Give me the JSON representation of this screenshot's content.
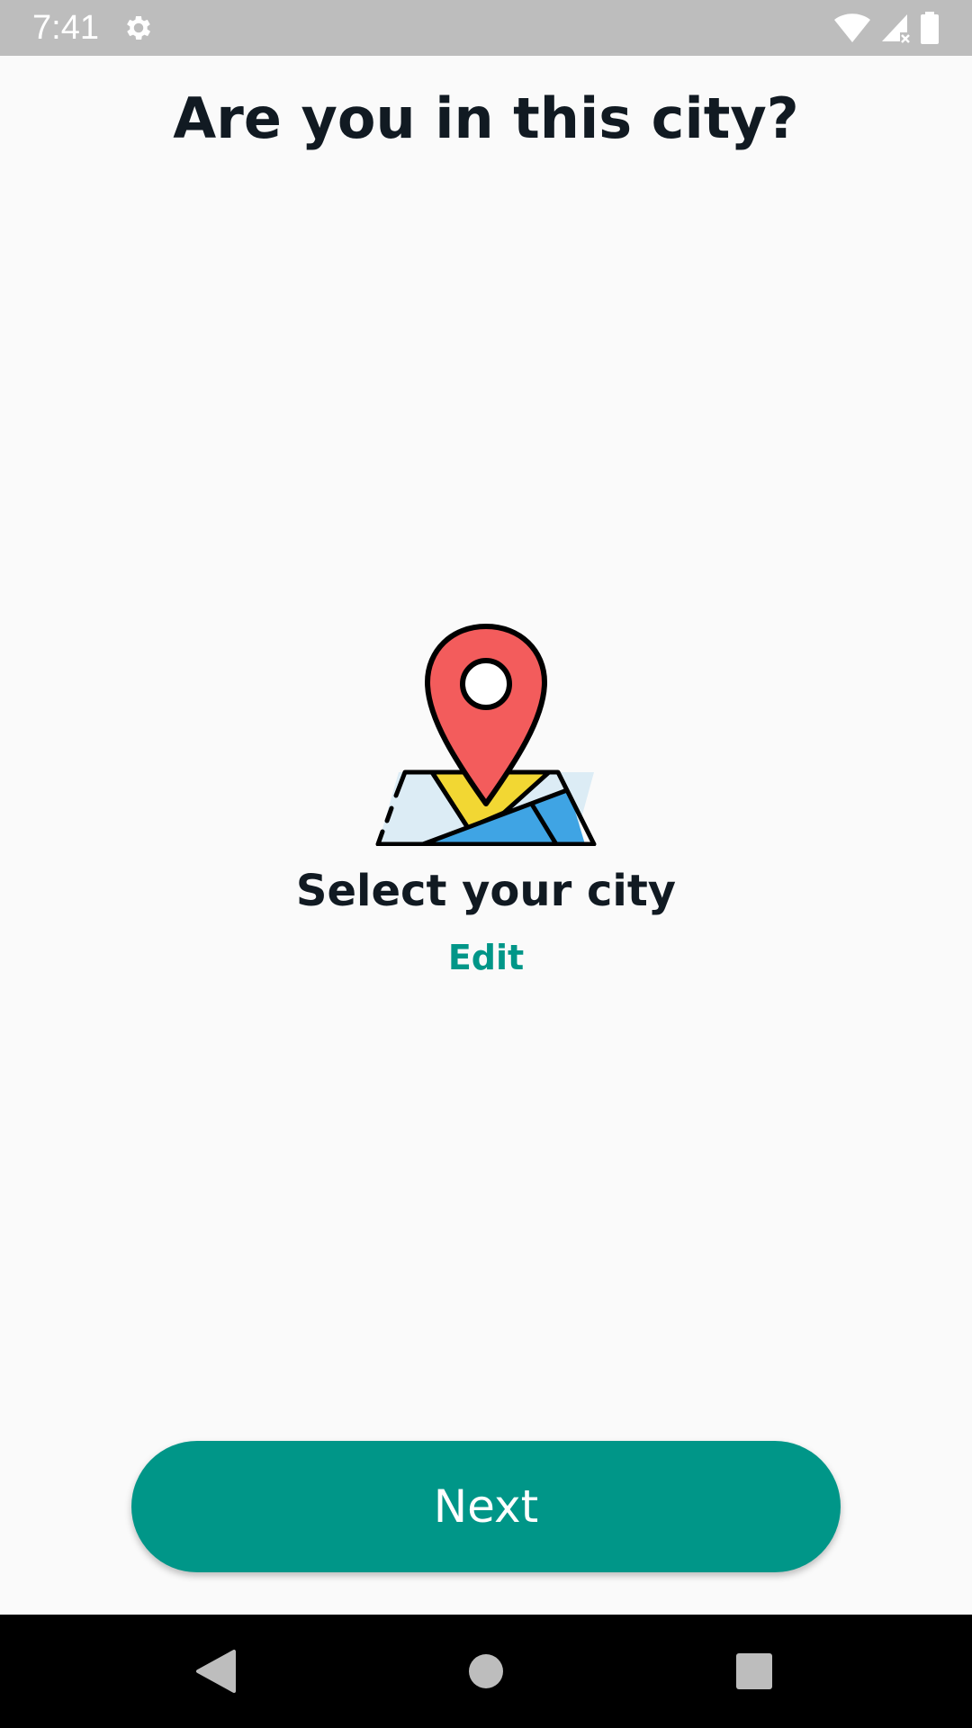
{
  "status_bar": {
    "time": "7:41",
    "icons": [
      "gear-icon",
      "wifi-icon",
      "signal-icon",
      "battery-icon"
    ]
  },
  "page": {
    "title": "Are you in this city?",
    "city_name": "Select your city",
    "edit_label": "Edit",
    "next_label": "Next"
  },
  "illustration": {
    "icon": "map-pin-icon",
    "colors": {
      "pin": "#f35c5c",
      "road": "#f2d733",
      "water": "#3fa4e4",
      "land": "#dcecf5",
      "outline": "#000000"
    }
  },
  "nav_bar": {
    "icons": [
      "back-icon",
      "home-icon",
      "recents-icon"
    ]
  },
  "colors": {
    "accent": "#009688",
    "text": "#111a22",
    "background": "#fafafa",
    "status_bar": "#bdbdbd"
  }
}
